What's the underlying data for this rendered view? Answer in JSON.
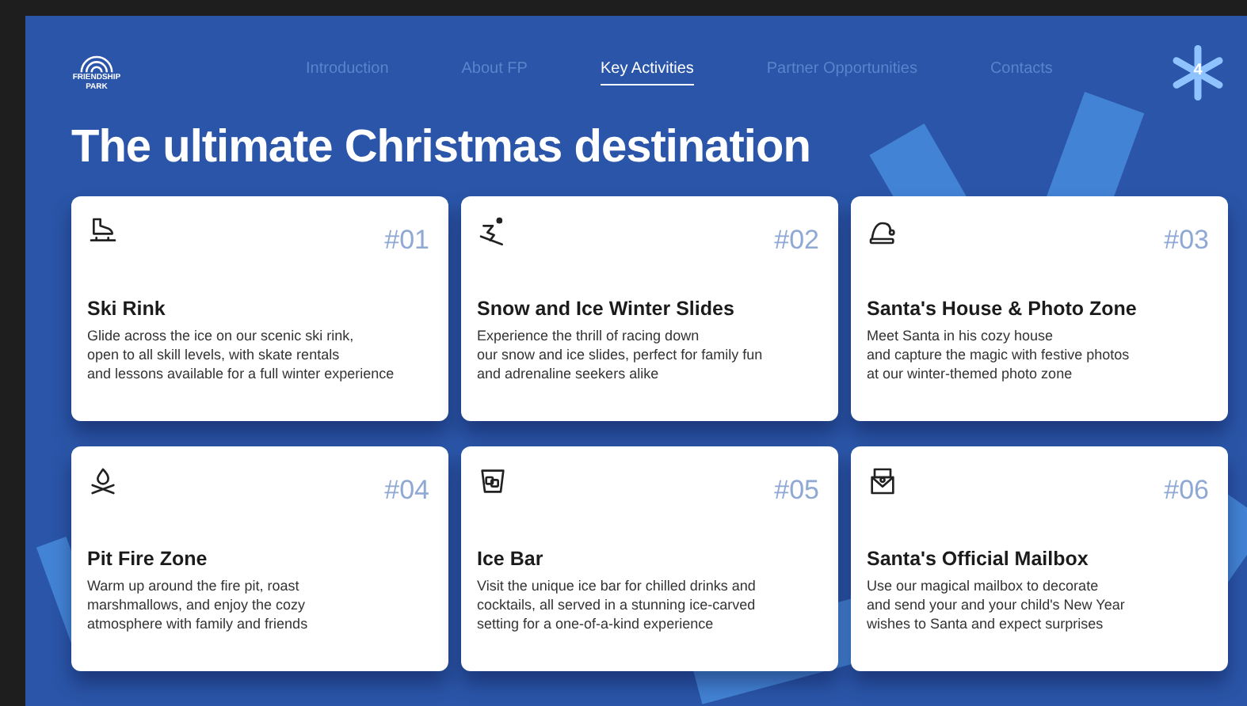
{
  "logo": {
    "line_1": "FRIENDSHIP",
    "line_2": "PARK"
  },
  "nav": [
    {
      "label": "Introduction",
      "selected": false
    },
    {
      "label": "About FP",
      "selected": false
    },
    {
      "label": "Key Activities",
      "selected": true
    },
    {
      "label": "Partner Opportunities",
      "selected": false
    },
    {
      "label": "Contacts",
      "selected": false
    }
  ],
  "page_number": "4",
  "title": "The ultimate Christmas destination",
  "cards": [
    {
      "kind": "skate",
      "number": "#01",
      "title": "Ski Rink",
      "lines": [
        "Glide across the ice on our scenic ski rink,",
        "open to all skill levels, with skate rentals",
        "and lessons available for a full winter experience"
      ]
    },
    {
      "kind": "skier",
      "number": "#02",
      "title": "Snow and Ice Winter Slides",
      "lines": [
        "Experience the thrill of racing down",
        "our snow and ice slides, perfect for family fun",
        "and adrenaline seekers alike"
      ]
    },
    {
      "kind": "hat",
      "number": "#03",
      "title": "Santa's House & Photo Zone",
      "lines": [
        "Meet Santa in his cozy house",
        "and capture the magic with festive photos",
        "at our winter-themed photo zone"
      ]
    },
    {
      "kind": "fire",
      "number": "#04",
      "title": "Pit Fire Zone",
      "lines": [
        "Warm up around the fire pit, roast",
        "marshmallows, and enjoy the cozy",
        "atmosphere with family and friends"
      ]
    },
    {
      "kind": "glass",
      "number": "#05",
      "title": "Ice Bar",
      "lines": [
        "Visit the unique ice bar for chilled drinks and",
        "cocktails, all served in a stunning ice-carved",
        "setting for a one-of-a-kind experience"
      ]
    },
    {
      "kind": "mailbox",
      "number": "#06",
      "title": "Santa's Official Mailbox",
      "lines": [
        "Use our magical mailbox to decorate",
        "and send your and your child's New Year",
        "wishes to Santa and expect surprises"
      ]
    }
  ]
}
